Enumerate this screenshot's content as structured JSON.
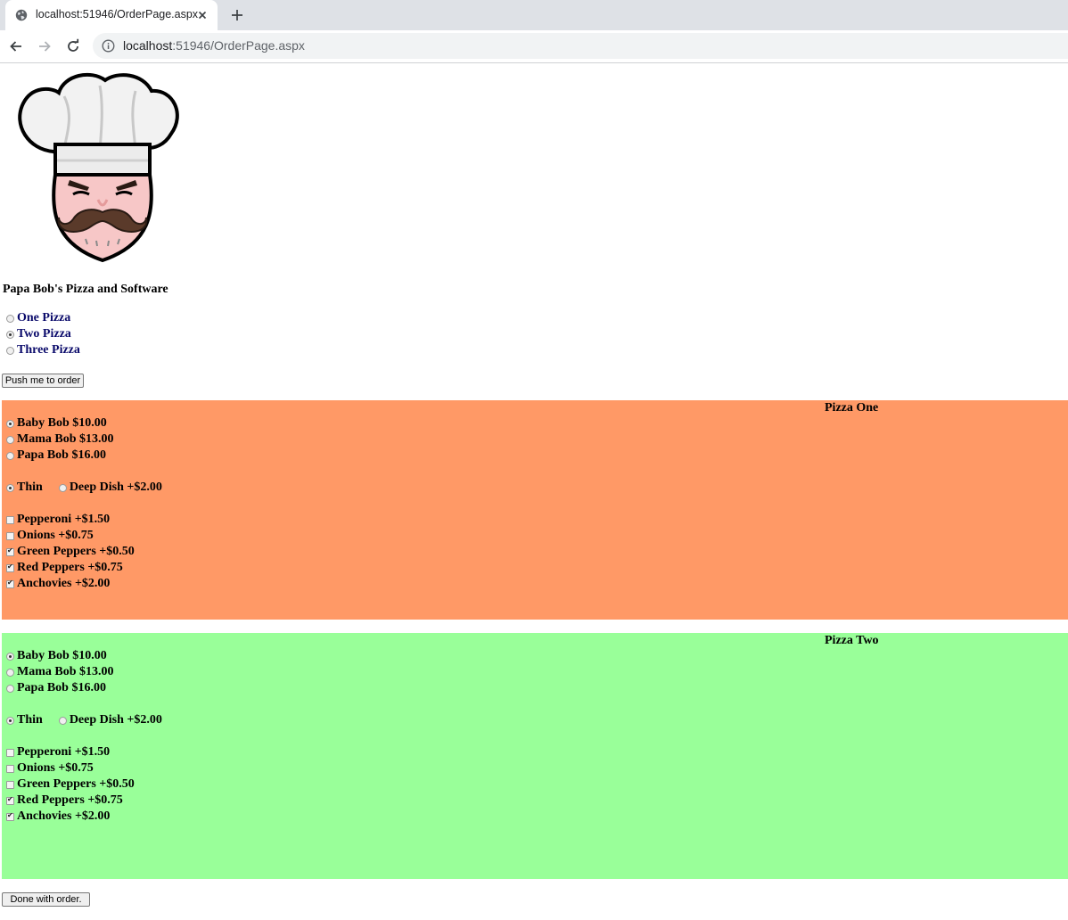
{
  "browser": {
    "tab_title": "localhost:51946/OrderPage.aspx",
    "url_host": "localhost",
    "url_rest": ":51946/OrderPage.aspx"
  },
  "page": {
    "site_title": "Papa Bob's Pizza and Software",
    "pizza_count_options": [
      {
        "label": "One Pizza",
        "selected": false
      },
      {
        "label": "Two Pizza",
        "selected": true
      },
      {
        "label": "Three Pizza",
        "selected": false
      }
    ],
    "order_button": "Push me to order",
    "done_button": "Done with order."
  },
  "pizzas": [
    {
      "title": "Pizza One",
      "background": "#ff9966",
      "sizes": [
        {
          "label": "Baby Bob $10.00",
          "selected": true
        },
        {
          "label": "Mama Bob $13.00",
          "selected": false
        },
        {
          "label": "Papa Bob $16.00",
          "selected": false
        }
      ],
      "crusts": [
        {
          "label": "Thin",
          "selected": true
        },
        {
          "label": "Deep Dish +$2.00",
          "selected": false
        }
      ],
      "toppings": [
        {
          "label": "Pepperoni +$1.50",
          "checked": false
        },
        {
          "label": "Onions +$0.75",
          "checked": false
        },
        {
          "label": "Green Peppers +$0.50",
          "checked": true
        },
        {
          "label": "Red Peppers +$0.75",
          "checked": true
        },
        {
          "label": "Anchovies +$2.00",
          "checked": true
        }
      ]
    },
    {
      "title": "Pizza Two",
      "background": "#99ff99",
      "sizes": [
        {
          "label": "Baby Bob $10.00",
          "selected": true
        },
        {
          "label": "Mama Bob $13.00",
          "selected": false
        },
        {
          "label": "Papa Bob $16.00",
          "selected": false
        }
      ],
      "crusts": [
        {
          "label": "Thin",
          "selected": true
        },
        {
          "label": "Deep Dish +$2.00",
          "selected": false
        }
      ],
      "toppings": [
        {
          "label": "Pepperoni +$1.50",
          "checked": false
        },
        {
          "label": "Onions +$0.75",
          "checked": false
        },
        {
          "label": "Green Peppers +$0.50",
          "checked": false
        },
        {
          "label": "Red Peppers +$0.75",
          "checked": true
        },
        {
          "label": "Anchovies +$2.00",
          "checked": true
        }
      ]
    }
  ]
}
